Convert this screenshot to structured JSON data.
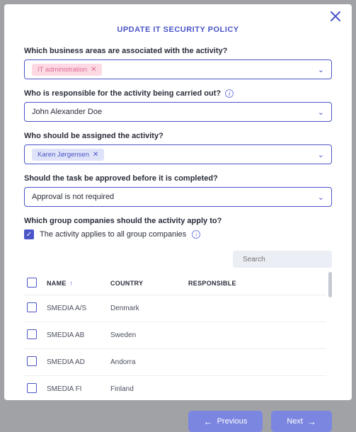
{
  "title": "UPDATE IT SECURITY POLICY",
  "fields": {
    "business_areas": {
      "label": "Which business areas are associated with the activity?",
      "tag": "IT administration"
    },
    "responsible": {
      "label": "Who is responsible for the activity being carried out?",
      "value": "John Alexander Doe"
    },
    "assigned": {
      "label": "Who should be assigned the activity?",
      "tag": "Karen Jørgensen"
    },
    "approval": {
      "label": "Should the task be approved before it is completed?",
      "value": "Approval is not required"
    },
    "groups": {
      "label": "Which group companies should the activity apply to?",
      "checkbox_label": "The activity applies to all group companies",
      "checked": true
    }
  },
  "search": {
    "placeholder": "Search"
  },
  "table": {
    "headers": {
      "name": "NAME",
      "country": "COUNTRY",
      "responsible": "RESPONSIBLE"
    },
    "rows": [
      {
        "name": "SMEDIA A/S",
        "country": "Denmark",
        "responsible": ""
      },
      {
        "name": "SMEDIA AB",
        "country": "Sweden",
        "responsible": ""
      },
      {
        "name": "SMEDIA AD",
        "country": "Andorra",
        "responsible": ""
      },
      {
        "name": "SMEDIA FI",
        "country": "Finland",
        "responsible": ""
      }
    ]
  },
  "buttons": {
    "previous": "Previous",
    "next": "Next"
  }
}
